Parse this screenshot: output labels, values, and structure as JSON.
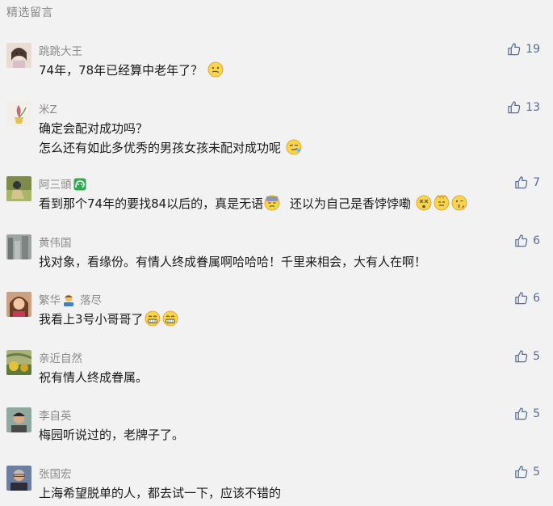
{
  "section_title": "精选留言",
  "comments": [
    {
      "nickname": "跳跳大王",
      "lines": [
        "74年，78年已经算中老年了？"
      ],
      "likes": "19",
      "emojis": [
        "thinking-emoji"
      ]
    },
    {
      "nickname": "米Z",
      "lines": [
        "确定会配对成功吗？",
        "怎么还有如此多优秀的男孩女孩未配对成功呢"
      ],
      "likes": "13",
      "emojis": [
        "smirk-emoji"
      ]
    },
    {
      "nickname": "阿三頭",
      "lines": [
        "看到那个74年的要找84以后的，真是无语",
        "还以为自己是香饽饽嘞"
      ],
      "likes": "7",
      "emojis": [
        "sweat-emoji",
        "dizzy-emoji",
        "facepalm-emoji",
        "kiss-emoji"
      ]
    },
    {
      "nickname": "黄伟国",
      "lines": [
        "找对象，看缘份。有情人终成眷属啊哈哈哈！千里来相会，大有人在啊！"
      ],
      "likes": "6"
    },
    {
      "nickname": "繁华",
      "nickname_extra": "落尽",
      "lines": [
        "我看上3号小哥哥了"
      ],
      "likes": "6",
      "emojis": [
        "grin-emoji",
        "grin-emoji"
      ]
    },
    {
      "nickname": "亲近自然",
      "lines": [
        "祝有情人终成眷属。"
      ],
      "likes": "5"
    },
    {
      "nickname": "李自英",
      "lines": [
        "梅园听说过的，老牌子了。"
      ],
      "likes": "5"
    },
    {
      "nickname": "张国宏",
      "lines": [
        "上海希望脱单的人，都去试一下，应该不错的"
      ],
      "likes": "5"
    }
  ],
  "colors": {
    "background": "#f2f2f2",
    "nickname": "#8a8a8a",
    "like": "#576b95",
    "text": "#1a1a1a"
  }
}
